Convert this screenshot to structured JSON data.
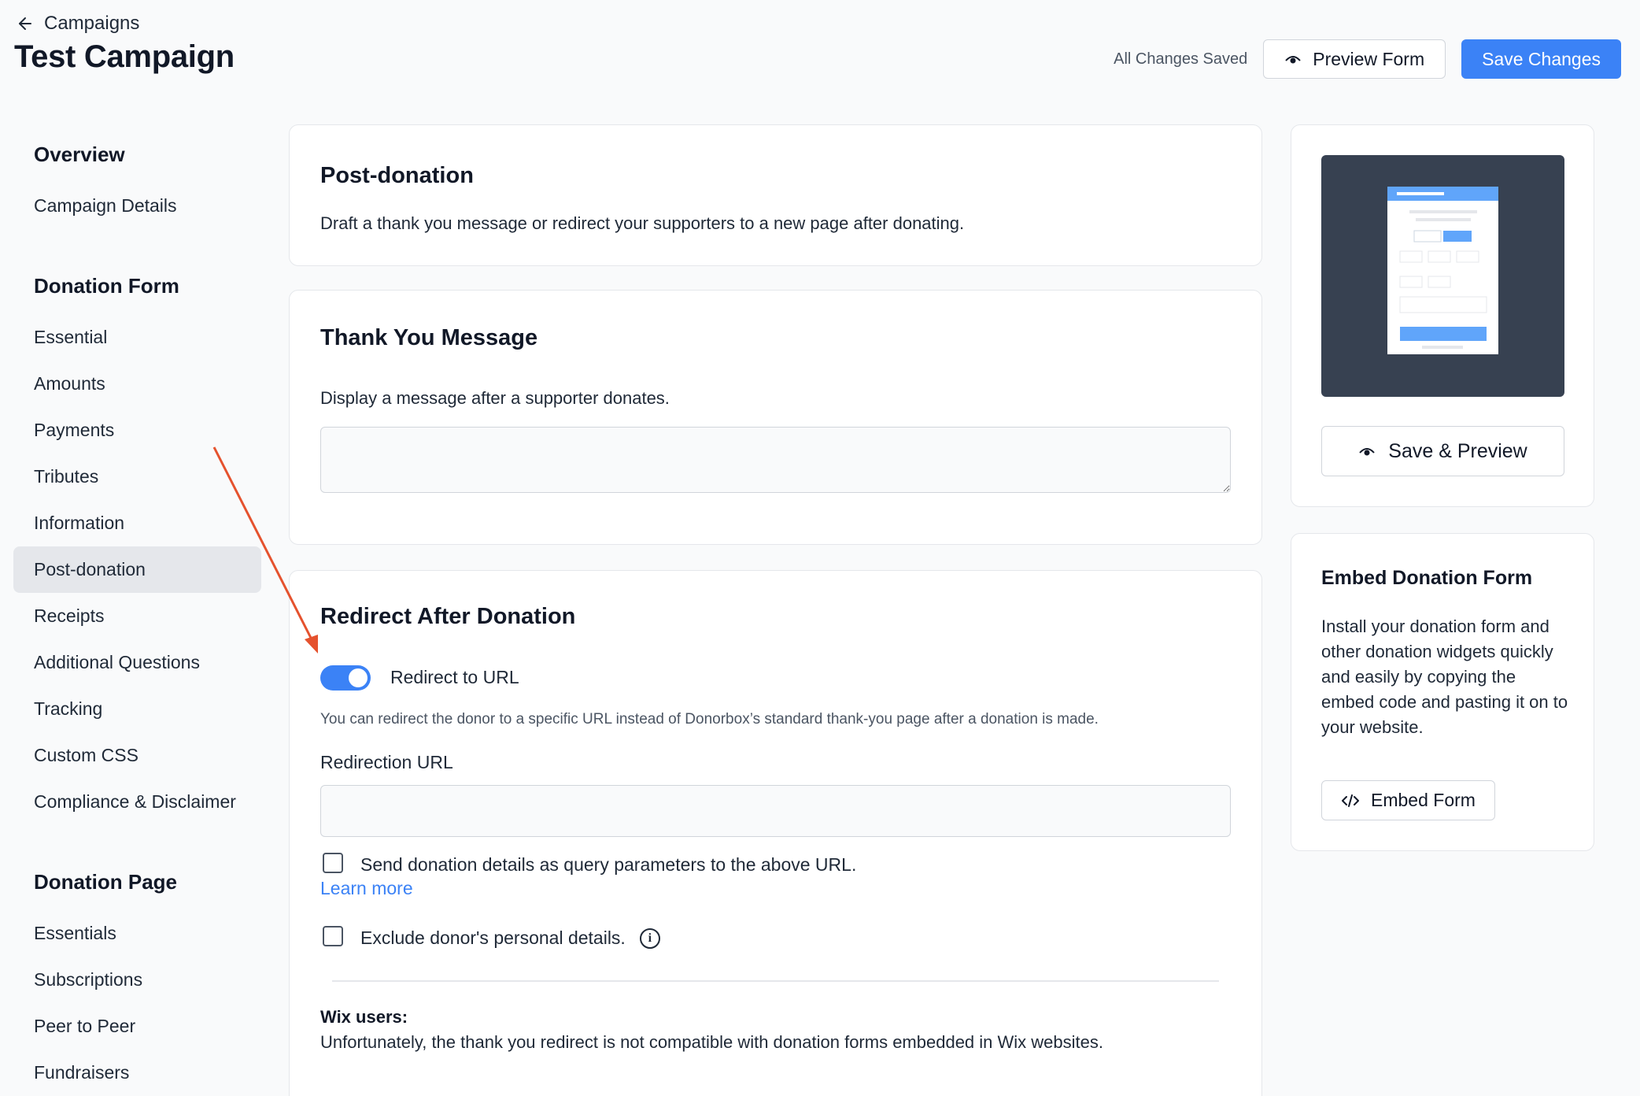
{
  "header": {
    "back_label": "Campaigns",
    "title": "Test Campaign",
    "save_status": "All Changes Saved",
    "preview_label": "Preview Form",
    "save_label": "Save Changes"
  },
  "sidebar": {
    "sections": [
      {
        "title": "Overview",
        "items": [
          "Campaign Details"
        ]
      },
      {
        "title": "Donation Form",
        "items": [
          "Essential",
          "Amounts",
          "Payments",
          "Tributes",
          "Information",
          "Post-donation",
          "Receipts",
          "Additional Questions",
          "Tracking",
          "Custom CSS",
          "Compliance & Disclaimer"
        ]
      },
      {
        "title": "Donation Page",
        "items": [
          "Essentials",
          "Subscriptions",
          "Peer to Peer",
          "Fundraisers"
        ]
      }
    ],
    "active_item": "Post-donation"
  },
  "post_donation": {
    "title": "Post-donation",
    "description": "Draft a thank you message or redirect your supporters to a new page after donating."
  },
  "thank_you": {
    "title": "Thank You Message",
    "description": "Display a message after a supporter donates.",
    "message_value": ""
  },
  "redirect": {
    "title": "Redirect After Donation",
    "toggle_label": "Redirect to URL",
    "toggle_on": true,
    "helper": "You can redirect the donor to a specific URL instead of Donorbox’s standard thank-you page after a donation is made.",
    "url_label": "Redirection URL",
    "url_value": "",
    "query_label": "Send donation details as query parameters to the above URL.",
    "learn_more": "Learn more",
    "exclude_label": "Exclude donor's personal details.",
    "info_glyph": "i",
    "wix_title": "Wix users:",
    "wix_text": "Unfortunately, the thank you redirect is not compatible with donation forms embedded in Wix websites."
  },
  "preview_panel": {
    "button_label": "Save & Preview"
  },
  "embed_panel": {
    "title": "Embed Donation Form",
    "description": "Install your donation form and other donation widgets quickly and easily by copying the embed code and pasting it on to your website.",
    "button_label": "Embed Form"
  },
  "colors": {
    "accent": "#3b82f6",
    "annotation_arrow": "#e5522e",
    "thumb_bg": "#374151"
  }
}
